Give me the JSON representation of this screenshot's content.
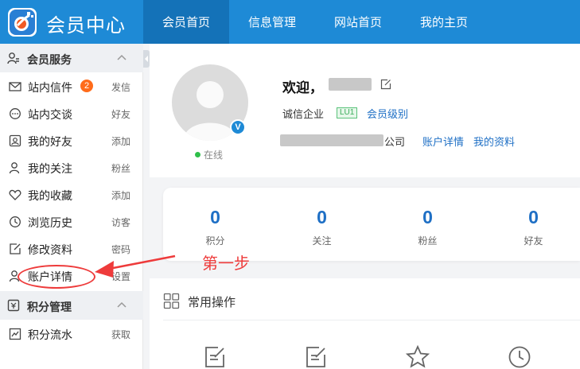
{
  "header": {
    "brand_title": "会员中心",
    "nav": [
      {
        "label": "会员首页",
        "active": true
      },
      {
        "label": "信息管理",
        "active": false
      },
      {
        "label": "网站首页",
        "active": false
      },
      {
        "label": "我的主页",
        "active": false
      }
    ]
  },
  "sidebar": {
    "groups": [
      {
        "title": "会员服务",
        "icon": "user-icon",
        "items": [
          {
            "label": "站内信件",
            "action": "发信",
            "icon": "mail-icon",
            "badge": "2"
          },
          {
            "label": "站内交谈",
            "action": "好友",
            "icon": "chat-icon"
          },
          {
            "label": "我的好友",
            "action": "添加",
            "icon": "contacts-icon"
          },
          {
            "label": "我的关注",
            "action": "粉丝",
            "icon": "user-icon"
          },
          {
            "label": "我的收藏",
            "action": "添加",
            "icon": "heart-icon"
          },
          {
            "label": "浏览历史",
            "action": "访客",
            "icon": "clock-icon"
          },
          {
            "label": "修改资料",
            "action": "密码",
            "icon": "edit-icon"
          },
          {
            "label": "账户详情",
            "action": "设置",
            "icon": "user-icon"
          }
        ]
      },
      {
        "title": "积分管理",
        "icon": "wallet-icon",
        "items": [
          {
            "label": "积分流水",
            "action": "获取",
            "icon": "chart-icon"
          }
        ]
      }
    ]
  },
  "annotation": {
    "text": "第一步",
    "color": "#ee3b3b"
  },
  "profile": {
    "welcome": "欢迎，",
    "status": "在线",
    "verified_mark": "V",
    "member_type": "诚信企业",
    "level_badge": "LU1",
    "level_link": "会员级别",
    "company_suffix": "公司",
    "links": [
      "账户详情",
      "我的资料"
    ]
  },
  "stats": [
    {
      "value": "0",
      "label": "积分"
    },
    {
      "value": "0",
      "label": "关注"
    },
    {
      "value": "0",
      "label": "粉丝"
    },
    {
      "value": "0",
      "label": "好友"
    }
  ],
  "operations": {
    "title": "常用操作"
  },
  "colors": {
    "primary": "#1e8ad6",
    "nav_active": "#1472b8",
    "link": "#1e6fc5",
    "badge": "#ff6b1a",
    "online": "#2fbf4a"
  }
}
